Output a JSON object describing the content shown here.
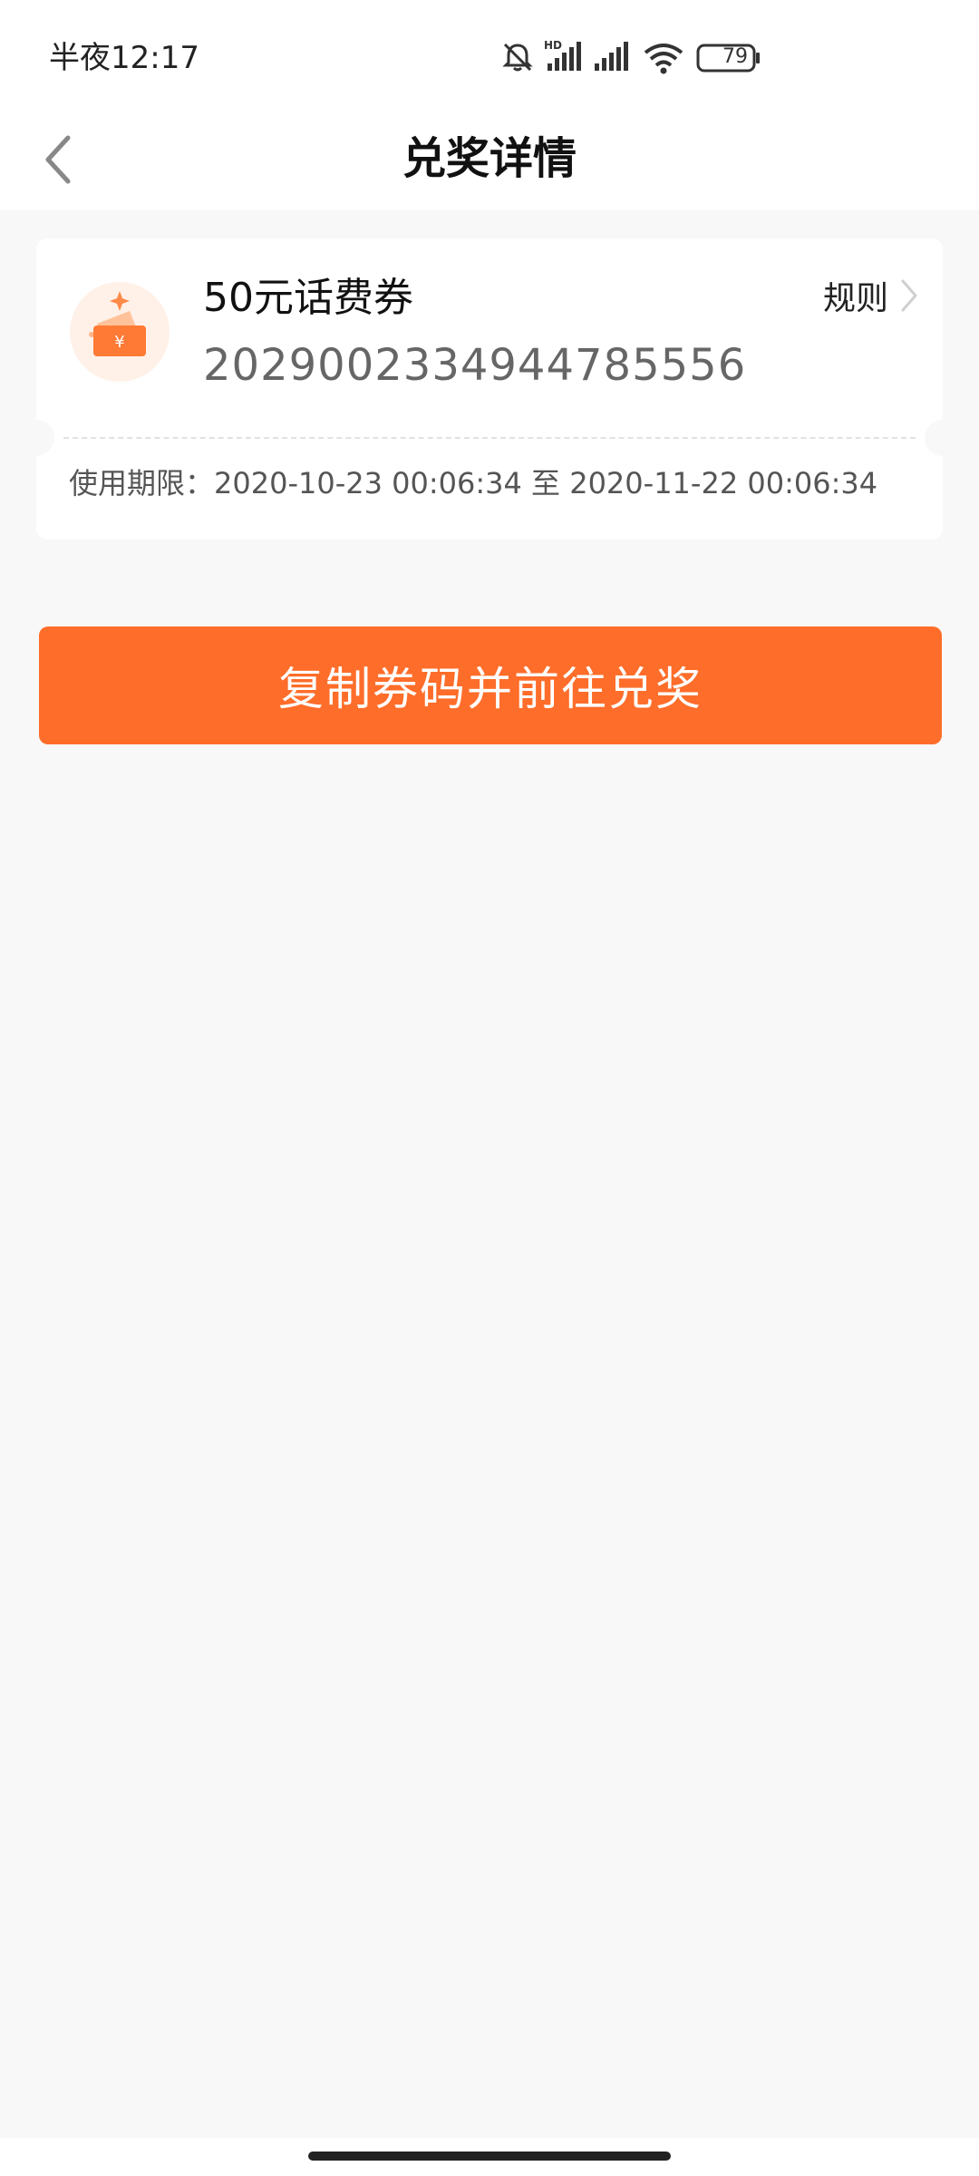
{
  "status_bar": {
    "time": "半夜12:17",
    "battery_level": "79",
    "icons": [
      "bell-muted-icon",
      "hd-signal-icon",
      "signal-icon",
      "wifi-icon",
      "battery-icon"
    ]
  },
  "header": {
    "title": "兑奖详情",
    "back_icon": "chevron-left-icon"
  },
  "coupon": {
    "icon": "ticket-yuan-icon",
    "name": "50元话费券",
    "code": "2029002334944785556",
    "rules_label": "规则",
    "validity": "使用期限：2020-10-23 00:06:34 至 2020-11-22 00:06:34"
  },
  "actions": {
    "redeem_label": "复制券码并前往兑奖"
  },
  "colors": {
    "accent": "#ff6d2a",
    "background": "#f8f8f8",
    "card": "#ffffff"
  }
}
